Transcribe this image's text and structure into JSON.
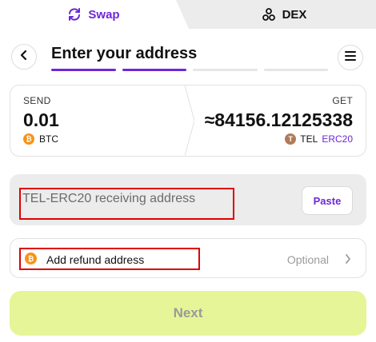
{
  "tabs": {
    "swap": {
      "label": "Swap",
      "icon": "swap-arrows-icon"
    },
    "dex": {
      "label": "DEX",
      "icon": "dex-nodes-icon"
    }
  },
  "header": {
    "title": "Enter your address",
    "progress": {
      "steps": 4,
      "active": 2
    }
  },
  "quote": {
    "send_label": "SEND",
    "send_amount": "0.01",
    "send_coin": "BTC",
    "get_label": "GET",
    "get_amount": "≈84156.12125338",
    "get_coin": "TEL",
    "get_network": "ERC20"
  },
  "address": {
    "placeholder": "TEL-ERC20 receiving address",
    "value": "",
    "paste_label": "Paste"
  },
  "refund": {
    "label": "Add refund address",
    "hint": "Optional"
  },
  "next_label": "Next",
  "colors": {
    "accent": "#6d28d9",
    "next_bg": "#e6f598",
    "highlight": "#e00000",
    "btc": "#f7931a",
    "tel": "#b07b5a"
  }
}
